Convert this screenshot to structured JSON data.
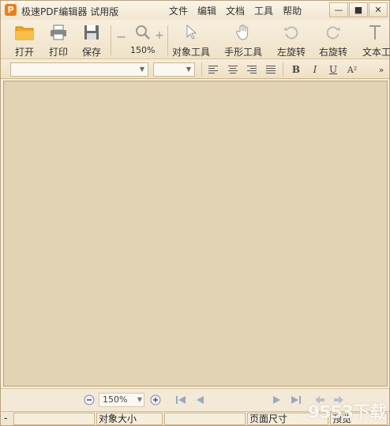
{
  "window": {
    "logo_letter": "P",
    "title": "极速PDF编辑器 试用版",
    "controls": {
      "minimize": "—",
      "maximize": "■",
      "close": "✕"
    }
  },
  "menu": [
    "文件",
    "编辑",
    "文档",
    "工具",
    "帮助"
  ],
  "toolbar": {
    "open": "打开",
    "print": "打印",
    "save": "保存",
    "zoom_minus": "−",
    "zoom_plus": "+",
    "zoom_value": "150%",
    "object_tool": "对象工具",
    "hand_tool": "手形工具",
    "rotate_left": "左旋转",
    "rotate_right": "右旋转",
    "text_tool": "文本工"
  },
  "format": {
    "font_name": "",
    "font_size": "",
    "bold": "B",
    "italic": "I",
    "underline": "U",
    "superscript": "A²",
    "more": "»"
  },
  "navbar": {
    "zoom_value": "150%"
  },
  "status": {
    "cell1": "-",
    "object_size_label": "对象大小",
    "page_size_label": "页面尺寸",
    "preview_label": "预览"
  },
  "watermark": "9553下载",
  "colors": {
    "logo": "#ee7d1b",
    "document_bg": "#e2d3b5",
    "folder": "#f2a71f"
  }
}
